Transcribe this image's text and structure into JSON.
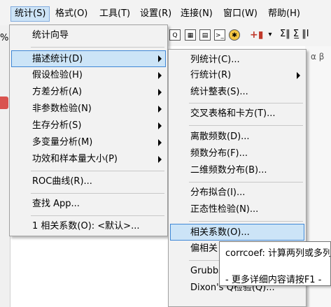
{
  "menubar": {
    "items": [
      {
        "label": "统计(S)",
        "active": true
      },
      {
        "label": "格式(O)"
      },
      {
        "label": "工具(T)"
      },
      {
        "label": "设置(R)"
      },
      {
        "label": "连接(N)"
      },
      {
        "label": "窗口(W)"
      },
      {
        "label": "帮助(H)"
      }
    ]
  },
  "background": {
    "percent_text": "%",
    "toolbar_text": "Σ‖ Σ̲ ‖Ι",
    "greek_text": "α β"
  },
  "stats_menu": {
    "items": [
      {
        "label": "统计向导"
      },
      {
        "label": "描述统计(D)",
        "submenu": true,
        "highlighted": true
      },
      {
        "label": "假设检验(H)",
        "submenu": true
      },
      {
        "label": "方差分析(A)",
        "submenu": true
      },
      {
        "label": "非参数检验(N)",
        "submenu": true
      },
      {
        "label": "生存分析(S)",
        "submenu": true
      },
      {
        "label": "多变量分析(M)",
        "submenu": true
      },
      {
        "label": "功效和样本量大小(P)",
        "submenu": true
      },
      {
        "label": "ROC曲线(R)..."
      },
      {
        "label": "查找 App..."
      },
      {
        "label": "1 相关系数(O): <默认>..."
      }
    ]
  },
  "desc_menu": {
    "items": [
      {
        "label": "列统计(C)..."
      },
      {
        "label": "行统计(R)",
        "submenu": true
      },
      {
        "label": "统计整表(S)..."
      },
      {
        "label": "交叉表格和卡方(T)..."
      },
      {
        "label": "离散频数(D)..."
      },
      {
        "label": "频数分布(F)..."
      },
      {
        "label": "二维频数分布(B)..."
      },
      {
        "label": "分布拟合(I)..."
      },
      {
        "label": "正态性检验(N)..."
      },
      {
        "label": "相关系数(O)...",
        "highlighted": true
      },
      {
        "label": "偏相关"
      },
      {
        "label": "Grubbs"
      },
      {
        "label": "Dixon's Q检验(Q)..."
      }
    ]
  },
  "tooltip": {
    "line1": "corrcoef: 计算两列或多列",
    "line2": "- 更多详细内容请按F1 -"
  }
}
